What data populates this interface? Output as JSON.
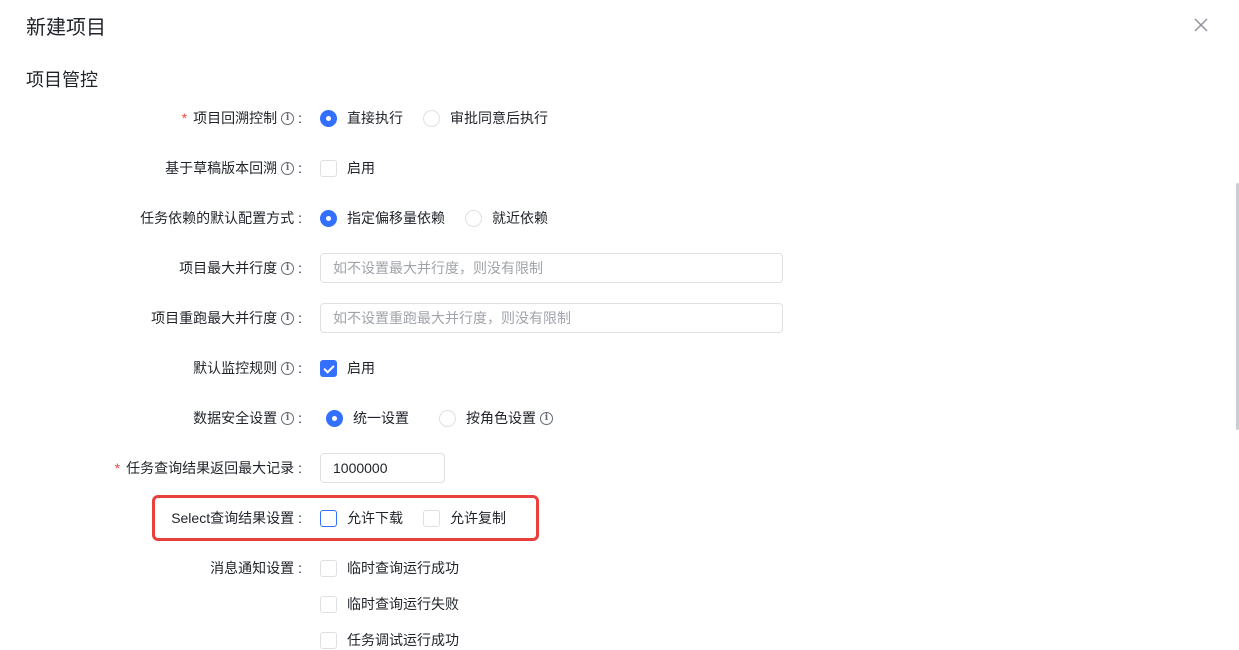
{
  "dialog": {
    "title": "新建项目",
    "section_title": "项目管控"
  },
  "form": {
    "backtrack_control": {
      "label": "项目回溯控制",
      "required": true,
      "options": [
        "直接执行",
        "审批同意后执行"
      ],
      "selected": "直接执行"
    },
    "draft_backtrack": {
      "label": "基于草稿版本回溯",
      "option": "启用",
      "checked": false
    },
    "dependency_mode": {
      "label": "任务依赖的默认配置方式",
      "options": [
        "指定偏移量依赖",
        "就近依赖"
      ],
      "selected": "指定偏移量依赖"
    },
    "max_parallel": {
      "label": "项目最大并行度",
      "placeholder": "如不设置最大并行度，则没有限制",
      "value": ""
    },
    "rerun_max_parallel": {
      "label": "项目重跑最大并行度",
      "placeholder": "如不设置重跑最大并行度，则没有限制",
      "value": ""
    },
    "default_monitor": {
      "label": "默认监控规则",
      "option": "启用",
      "checked": true
    },
    "data_security": {
      "label": "数据安全设置",
      "options": [
        "统一设置",
        "按角色设置"
      ],
      "selected": "统一设置"
    },
    "max_records": {
      "label": "任务查询结果返回最大记录",
      "required": true,
      "value": "1000000"
    },
    "select_result": {
      "label": "Select查询结果设置",
      "options": [
        "允许下载",
        "允许复制"
      ],
      "checked": [
        false,
        false
      ]
    },
    "notification": {
      "label": "消息通知设置",
      "options": [
        "临时查询运行成功",
        "临时查询运行失败",
        "任务调试运行成功"
      ],
      "checked": [
        false,
        false,
        false
      ]
    }
  },
  "colors": {
    "accent": "#3370ff",
    "highlight": "#e8403d",
    "required": "#f54a45"
  }
}
